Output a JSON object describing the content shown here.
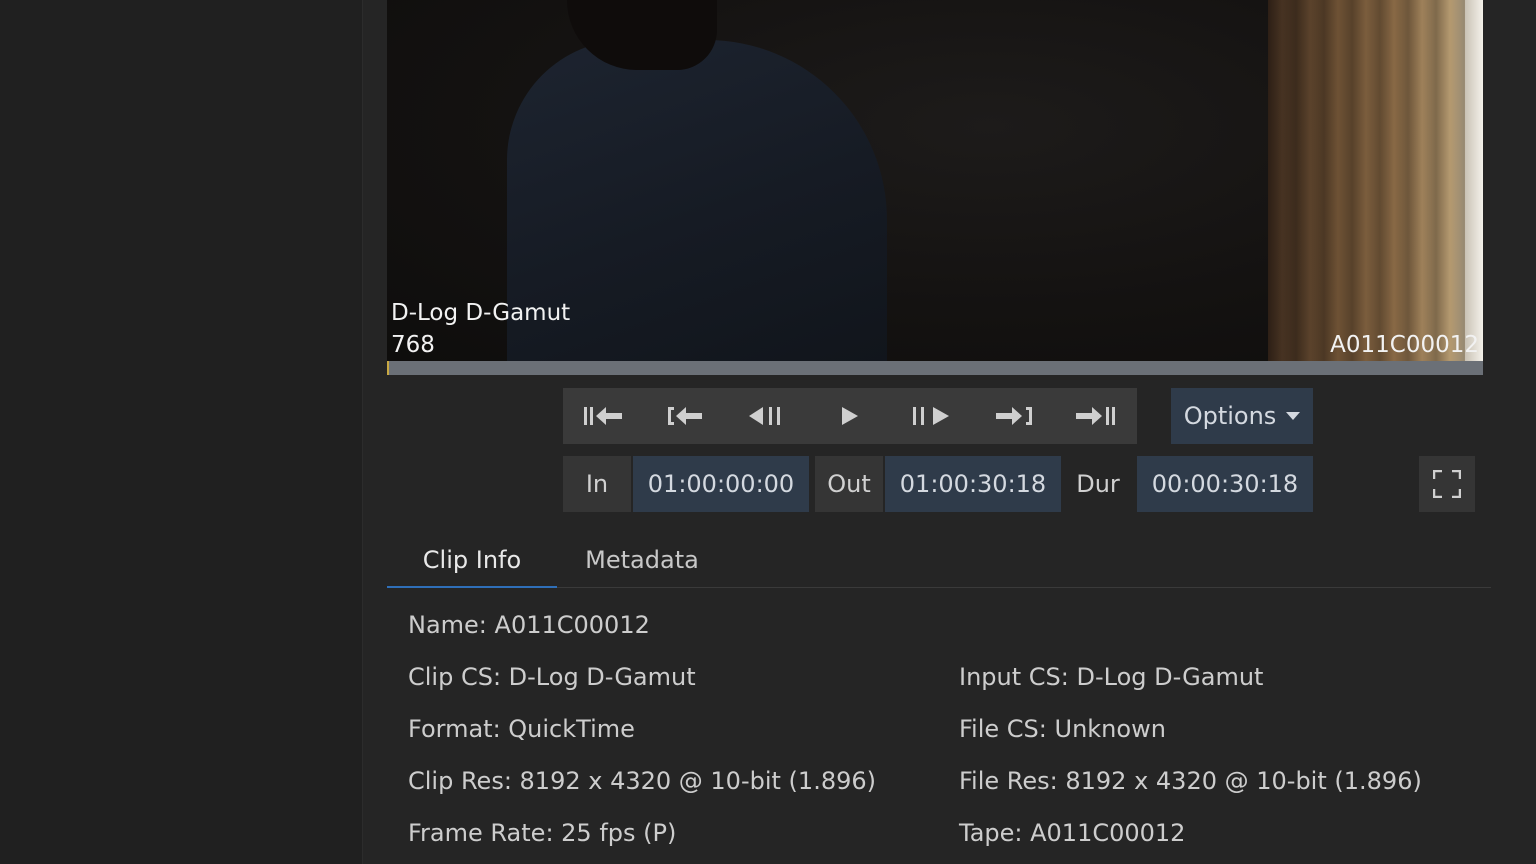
{
  "viewer": {
    "colorspace_overlay": "D-Log D-Gamut",
    "frame_overlay": "768",
    "clip_overlay": "A011C00012",
    "playhead_fraction": 0.0
  },
  "transport": {
    "buttons": [
      {
        "name": "go-to-start-icon"
      },
      {
        "name": "go-to-in-icon"
      },
      {
        "name": "step-back-icon"
      },
      {
        "name": "play-icon"
      },
      {
        "name": "step-forward-icon"
      },
      {
        "name": "go-to-out-icon"
      },
      {
        "name": "go-to-end-icon"
      }
    ],
    "options_label": "Options"
  },
  "timecode": {
    "in_label": "In",
    "in_value": "01:00:00:00",
    "out_label": "Out",
    "out_value": "01:00:30:18",
    "dur_label": "Dur",
    "dur_value": "00:00:30:18"
  },
  "tabs": [
    {
      "label": "Clip Info",
      "active": true
    },
    {
      "label": "Metadata",
      "active": false
    }
  ],
  "clip_info": {
    "name": "Name: A011C00012",
    "clip_cs": "Clip CS: D-Log D-Gamut",
    "input_cs": "Input CS: D-Log D-Gamut",
    "format": "Format: QuickTime",
    "file_cs": "File CS: Unknown",
    "clip_res": "Clip Res: 8192 x 4320 @ 10-bit (1.896)",
    "file_res": "File Res: 8192 x 4320 @ 10-bit (1.896)",
    "frame_rate": "Frame Rate: 25 fps (P)",
    "tape": "Tape: A011C00012"
  },
  "colors": {
    "accent": "#2f6fb8",
    "field_bg": "#2f3b4a",
    "playhead": "#c8a842"
  }
}
